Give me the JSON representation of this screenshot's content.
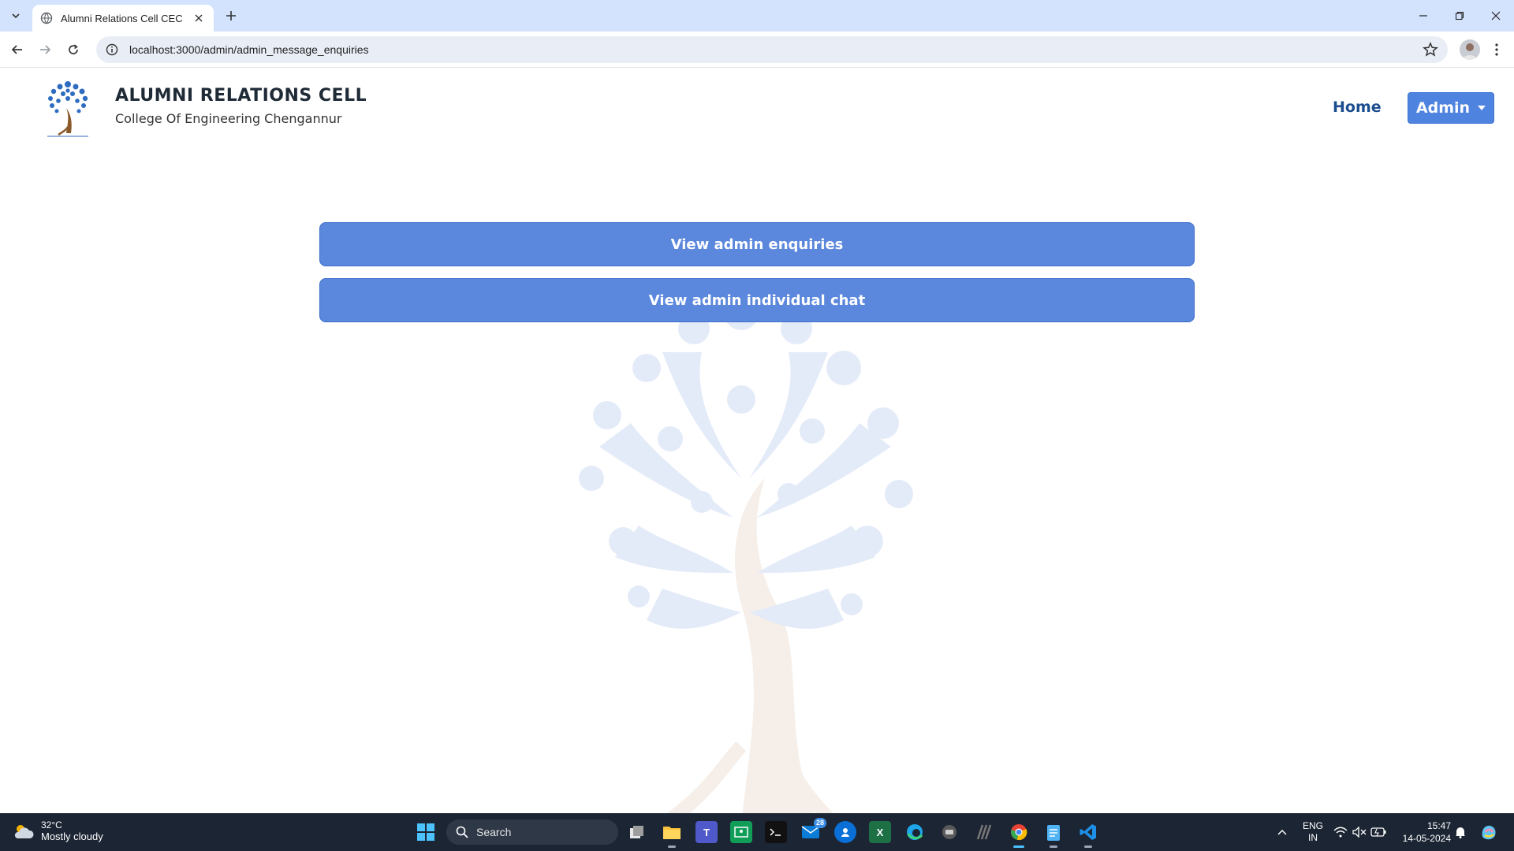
{
  "browser": {
    "tab_title": "Alumni Relations Cell CEC",
    "url": "localhost:3000/admin/admin_message_enquiries"
  },
  "header": {
    "title": "ALUMNI RELATIONS CELL",
    "subtitle": "College Of Engineering Chengannur",
    "nav_home": "Home",
    "nav_admin": "Admin"
  },
  "main": {
    "buttons": [
      {
        "label": "View admin enquiries"
      },
      {
        "label": "View admin individual chat"
      }
    ]
  },
  "taskbar": {
    "weather_temp": "32°C",
    "weather_condition": "Mostly cloudy",
    "search_placeholder": "Search",
    "mail_badge": "28",
    "lang_line1": "ENG",
    "lang_line2": "IN",
    "time": "15:47",
    "date": "14-05-2024"
  },
  "colors": {
    "primary_button": "#5b87dc",
    "nav_link": "#1b4d8f",
    "tab_strip": "#d3e3fd",
    "taskbar": "#1c2533"
  }
}
